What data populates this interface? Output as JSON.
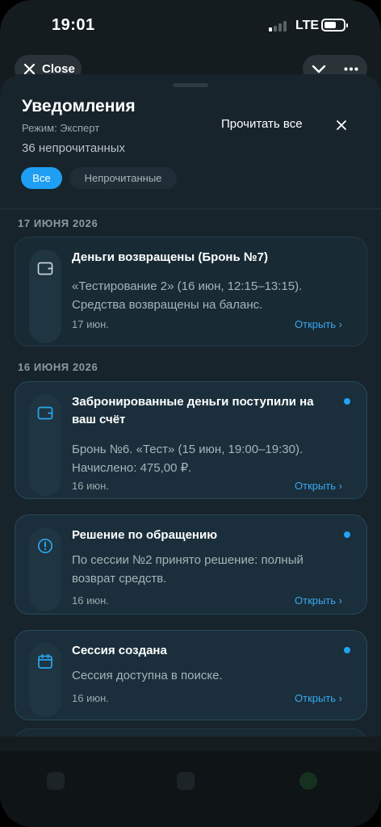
{
  "status_bar": {
    "time": "19:01",
    "network": "LTE"
  },
  "top_bar": {
    "close_label": "Close"
  },
  "sheet": {
    "title": "Уведомления",
    "mode": "Режим: Эксперт",
    "unread_count": "36 непрочитанных",
    "read_all": "Прочитать все",
    "filters": {
      "all": "Все",
      "unread": "Непрочитанные"
    }
  },
  "groups": [
    {
      "date": "17 ИЮНЯ 2026"
    },
    {
      "date": "16 ИЮНЯ 2026"
    }
  ],
  "notifications": [
    {
      "icon": "wallet-icon",
      "title": "Деньги возвращены (Бронь №7)",
      "body": "«Тестирование 2» (16 июн, 12:15–13:15). Средства возвращены на баланс.",
      "date": "17 июн.",
      "open": "Открыть ›",
      "unread": false
    },
    {
      "icon": "wallet-icon",
      "title": "Забронированные деньги поступили на ваш счёт",
      "body": "Бронь №6. «Тест» (15 июн, 19:00–19:30). Начислено: 475,00 ₽.",
      "date": "16 июн.",
      "open": "Открыть ›",
      "unread": true
    },
    {
      "icon": "alert-circle-icon",
      "title": "Решение по обращению",
      "body": "По сессии №2 принято решение: полный возврат средств.",
      "date": "16 июн.",
      "open": "Открыть ›",
      "unread": true
    },
    {
      "icon": "calendar-icon",
      "title": "Сессия создана",
      "body": "Сессия доступна в поиске.",
      "date": "16 июн.",
      "open": "Открыть ›",
      "unread": true
    }
  ],
  "colors": {
    "accent": "#1f9ff3",
    "link": "#3aa7f0",
    "unread_dot": "#22a4f5",
    "sheet_bg": "#17242c",
    "card_bg": "#182a34",
    "icon_wallet": "#c9d2d8",
    "icon_blue": "#2aa6f2"
  }
}
